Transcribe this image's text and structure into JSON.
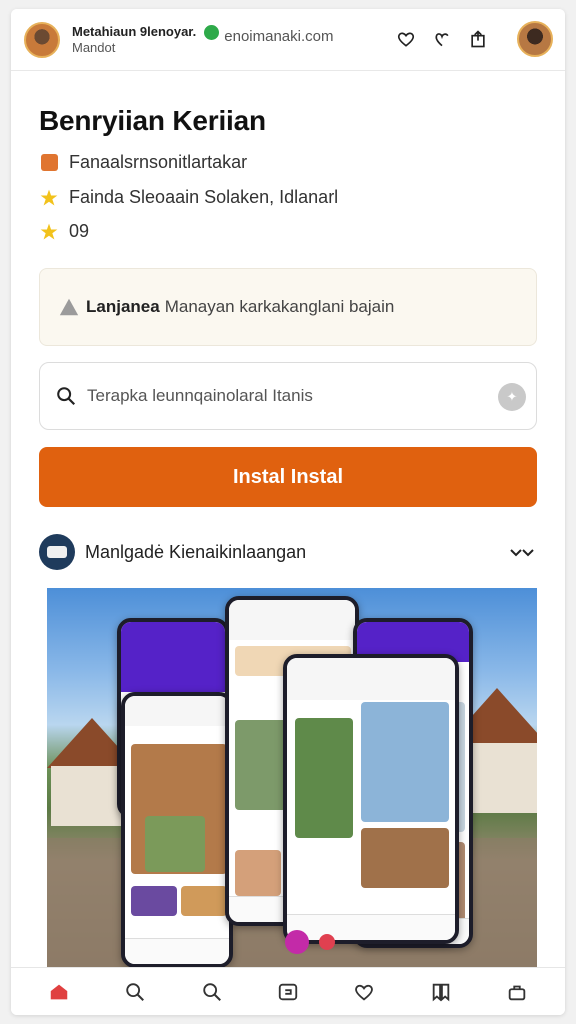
{
  "header": {
    "account_name": "Metahiaun 9lenoyar.",
    "account_sub": "Mandot",
    "domain": "enoimanaki.com"
  },
  "app": {
    "title": "Benryiian Keriian",
    "developer": "Fanaalsrnsonitlartakar",
    "category": "Fainda Sleoaain Solaken, Idlanarl",
    "rating": "09"
  },
  "notice": {
    "bold": "Lanjanea",
    "text": "Manayan karkakanglani bajain"
  },
  "search": {
    "placeholder": "Terapka leunnqainolaral Itanis"
  },
  "install": {
    "label": "Instal Instal"
  },
  "section": {
    "title": "Manlgadė Kienaikinlaangan"
  },
  "colors": {
    "accent": "#e0610f",
    "purple": "#5522c8",
    "verified": "#2eaa4a",
    "active_nav": "#e04040"
  },
  "bottom_nav": [
    {
      "icon": "home-icon"
    },
    {
      "icon": "search-icon"
    },
    {
      "icon": "search-icon"
    },
    {
      "icon": "grid-icon"
    },
    {
      "icon": "heart-icon"
    },
    {
      "icon": "bookmark-icon"
    },
    {
      "icon": "bag-icon"
    }
  ]
}
